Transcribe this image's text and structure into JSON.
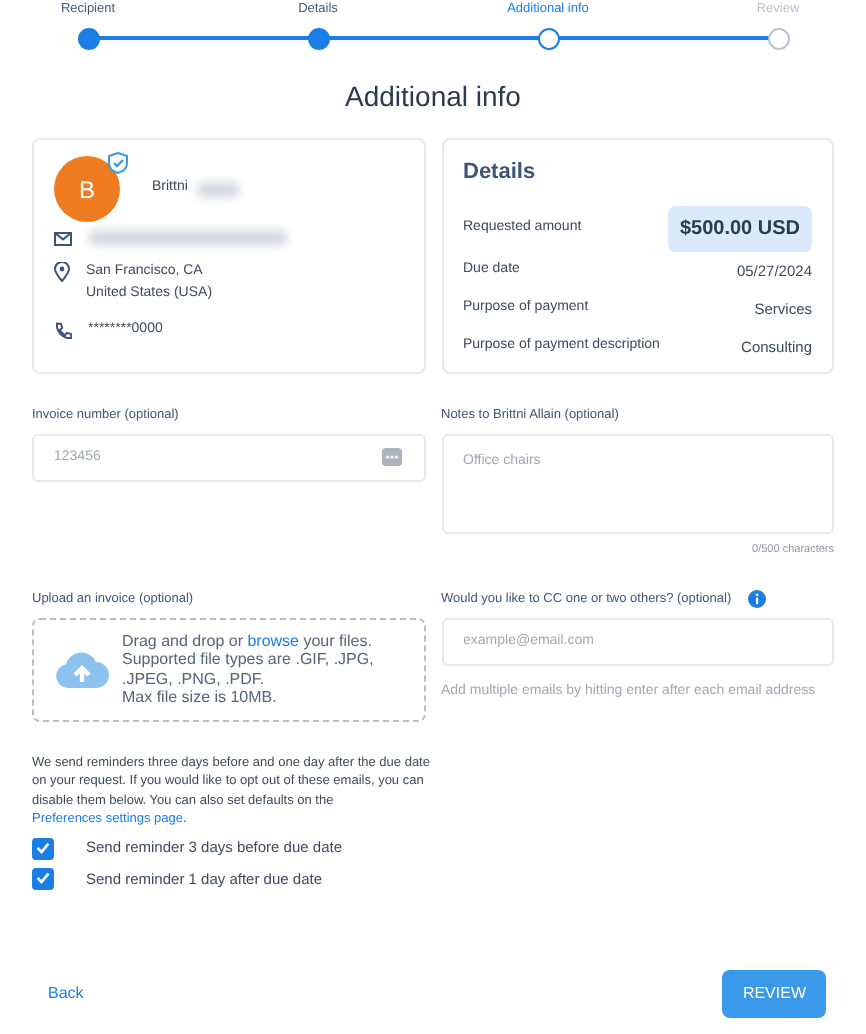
{
  "stepper": [
    {
      "label": "Recipient",
      "done": true,
      "selected": false
    },
    {
      "label": "Details",
      "done": true,
      "selected": false
    },
    {
      "label": "Additional info",
      "done": false,
      "selected": true
    },
    {
      "label": "Review",
      "done": false,
      "selected": false
    }
  ],
  "title": "Additional info",
  "recipient": {
    "initial": "B",
    "verified": true,
    "first_name": "Brittni",
    "name_redacted": true,
    "email_redacted": true,
    "address": [
      "San Francisco, CA",
      "United States (USA)"
    ],
    "phone": "********0000"
  },
  "details": {
    "title": "Details",
    "amount_label": "Requested amount",
    "amount": "$500.00 USD",
    "rows": [
      {
        "label": "Due date",
        "value": "05/27/2024"
      },
      {
        "label": "Purpose of payment",
        "value": "Services"
      },
      {
        "label": "Purpose of payment description",
        "value": "Consulting"
      }
    ]
  },
  "invoice_number": {
    "label": "Invoice number (optional)",
    "placeholder": "123456"
  },
  "notes": {
    "label": "Notes to Brittni Allain (optional)",
    "placeholder": "Office chairs",
    "counter": "0/500 characters"
  },
  "upload": {
    "label": "Upload an invoice (optional)",
    "lead": "Drag and drop or ",
    "link": "browse",
    "lead_end": " your files.",
    "lines": [
      "Supported file types are .GIF, .JPG,",
      ".JPEG, .PNG, .PDF.",
      "Max file size is 10MB."
    ]
  },
  "cc": {
    "label": "Would you like to CC one or two others? (optional)",
    "placeholder": "example@email.com",
    "hint": "Add multiple emails by hitting enter after each email address"
  },
  "reminders": {
    "text": "We send reminders three days before and one day after the due date on your request. If you would like to opt out of these emails, you can disable them below. You can also set defaults on the ",
    "link": "Preferences settings page",
    "text_end": ".",
    "options": [
      {
        "label": "Send reminder 3 days before due date",
        "checked": true
      },
      {
        "label": "Send reminder 1 day after due date",
        "checked": true
      }
    ]
  },
  "back": "Back",
  "review": "REVIEW"
}
